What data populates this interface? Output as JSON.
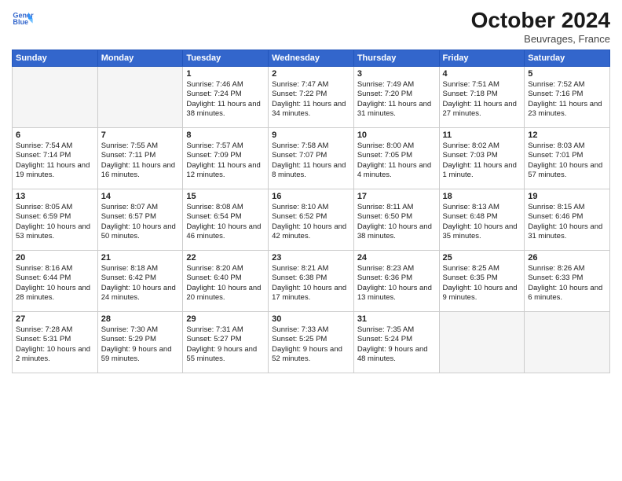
{
  "logo": {
    "line1": "General",
    "line2": "Blue"
  },
  "header": {
    "month": "October 2024",
    "location": "Beuvrages, France"
  },
  "days_of_week": [
    "Sunday",
    "Monday",
    "Tuesday",
    "Wednesday",
    "Thursday",
    "Friday",
    "Saturday"
  ],
  "weeks": [
    [
      {
        "day": "",
        "empty": true
      },
      {
        "day": "",
        "empty": true
      },
      {
        "day": "1",
        "sunrise": "Sunrise: 7:46 AM",
        "sunset": "Sunset: 7:24 PM",
        "daylight": "Daylight: 11 hours and 38 minutes."
      },
      {
        "day": "2",
        "sunrise": "Sunrise: 7:47 AM",
        "sunset": "Sunset: 7:22 PM",
        "daylight": "Daylight: 11 hours and 34 minutes."
      },
      {
        "day": "3",
        "sunrise": "Sunrise: 7:49 AM",
        "sunset": "Sunset: 7:20 PM",
        "daylight": "Daylight: 11 hours and 31 minutes."
      },
      {
        "day": "4",
        "sunrise": "Sunrise: 7:51 AM",
        "sunset": "Sunset: 7:18 PM",
        "daylight": "Daylight: 11 hours and 27 minutes."
      },
      {
        "day": "5",
        "sunrise": "Sunrise: 7:52 AM",
        "sunset": "Sunset: 7:16 PM",
        "daylight": "Daylight: 11 hours and 23 minutes."
      }
    ],
    [
      {
        "day": "6",
        "sunrise": "Sunrise: 7:54 AM",
        "sunset": "Sunset: 7:14 PM",
        "daylight": "Daylight: 11 hours and 19 minutes."
      },
      {
        "day": "7",
        "sunrise": "Sunrise: 7:55 AM",
        "sunset": "Sunset: 7:11 PM",
        "daylight": "Daylight: 11 hours and 16 minutes."
      },
      {
        "day": "8",
        "sunrise": "Sunrise: 7:57 AM",
        "sunset": "Sunset: 7:09 PM",
        "daylight": "Daylight: 11 hours and 12 minutes."
      },
      {
        "day": "9",
        "sunrise": "Sunrise: 7:58 AM",
        "sunset": "Sunset: 7:07 PM",
        "daylight": "Daylight: 11 hours and 8 minutes."
      },
      {
        "day": "10",
        "sunrise": "Sunrise: 8:00 AM",
        "sunset": "Sunset: 7:05 PM",
        "daylight": "Daylight: 11 hours and 4 minutes."
      },
      {
        "day": "11",
        "sunrise": "Sunrise: 8:02 AM",
        "sunset": "Sunset: 7:03 PM",
        "daylight": "Daylight: 11 hours and 1 minute."
      },
      {
        "day": "12",
        "sunrise": "Sunrise: 8:03 AM",
        "sunset": "Sunset: 7:01 PM",
        "daylight": "Daylight: 10 hours and 57 minutes."
      }
    ],
    [
      {
        "day": "13",
        "sunrise": "Sunrise: 8:05 AM",
        "sunset": "Sunset: 6:59 PM",
        "daylight": "Daylight: 10 hours and 53 minutes."
      },
      {
        "day": "14",
        "sunrise": "Sunrise: 8:07 AM",
        "sunset": "Sunset: 6:57 PM",
        "daylight": "Daylight: 10 hours and 50 minutes."
      },
      {
        "day": "15",
        "sunrise": "Sunrise: 8:08 AM",
        "sunset": "Sunset: 6:54 PM",
        "daylight": "Daylight: 10 hours and 46 minutes."
      },
      {
        "day": "16",
        "sunrise": "Sunrise: 8:10 AM",
        "sunset": "Sunset: 6:52 PM",
        "daylight": "Daylight: 10 hours and 42 minutes."
      },
      {
        "day": "17",
        "sunrise": "Sunrise: 8:11 AM",
        "sunset": "Sunset: 6:50 PM",
        "daylight": "Daylight: 10 hours and 38 minutes."
      },
      {
        "day": "18",
        "sunrise": "Sunrise: 8:13 AM",
        "sunset": "Sunset: 6:48 PM",
        "daylight": "Daylight: 10 hours and 35 minutes."
      },
      {
        "day": "19",
        "sunrise": "Sunrise: 8:15 AM",
        "sunset": "Sunset: 6:46 PM",
        "daylight": "Daylight: 10 hours and 31 minutes."
      }
    ],
    [
      {
        "day": "20",
        "sunrise": "Sunrise: 8:16 AM",
        "sunset": "Sunset: 6:44 PM",
        "daylight": "Daylight: 10 hours and 28 minutes."
      },
      {
        "day": "21",
        "sunrise": "Sunrise: 8:18 AM",
        "sunset": "Sunset: 6:42 PM",
        "daylight": "Daylight: 10 hours and 24 minutes."
      },
      {
        "day": "22",
        "sunrise": "Sunrise: 8:20 AM",
        "sunset": "Sunset: 6:40 PM",
        "daylight": "Daylight: 10 hours and 20 minutes."
      },
      {
        "day": "23",
        "sunrise": "Sunrise: 8:21 AM",
        "sunset": "Sunset: 6:38 PM",
        "daylight": "Daylight: 10 hours and 17 minutes."
      },
      {
        "day": "24",
        "sunrise": "Sunrise: 8:23 AM",
        "sunset": "Sunset: 6:36 PM",
        "daylight": "Daylight: 10 hours and 13 minutes."
      },
      {
        "day": "25",
        "sunrise": "Sunrise: 8:25 AM",
        "sunset": "Sunset: 6:35 PM",
        "daylight": "Daylight: 10 hours and 9 minutes."
      },
      {
        "day": "26",
        "sunrise": "Sunrise: 8:26 AM",
        "sunset": "Sunset: 6:33 PM",
        "daylight": "Daylight: 10 hours and 6 minutes."
      }
    ],
    [
      {
        "day": "27",
        "sunrise": "Sunrise: 7:28 AM",
        "sunset": "Sunset: 5:31 PM",
        "daylight": "Daylight: 10 hours and 2 minutes."
      },
      {
        "day": "28",
        "sunrise": "Sunrise: 7:30 AM",
        "sunset": "Sunset: 5:29 PM",
        "daylight": "Daylight: 9 hours and 59 minutes."
      },
      {
        "day": "29",
        "sunrise": "Sunrise: 7:31 AM",
        "sunset": "Sunset: 5:27 PM",
        "daylight": "Daylight: 9 hours and 55 minutes."
      },
      {
        "day": "30",
        "sunrise": "Sunrise: 7:33 AM",
        "sunset": "Sunset: 5:25 PM",
        "daylight": "Daylight: 9 hours and 52 minutes."
      },
      {
        "day": "31",
        "sunrise": "Sunrise: 7:35 AM",
        "sunset": "Sunset: 5:24 PM",
        "daylight": "Daylight: 9 hours and 48 minutes."
      },
      {
        "day": "",
        "empty": true
      },
      {
        "day": "",
        "empty": true
      }
    ]
  ]
}
